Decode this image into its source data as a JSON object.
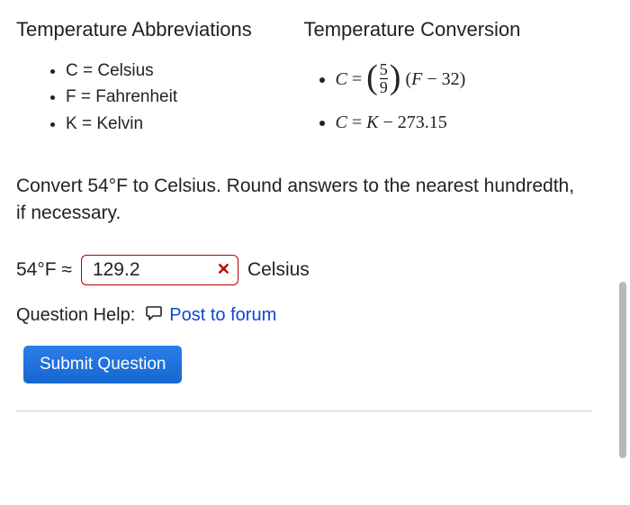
{
  "headings": {
    "abbrev": "Temperature Abbreviations",
    "conv": "Temperature Conversion"
  },
  "abbreviations": [
    "C = Celsius",
    "F = Fahrenheit",
    "K = Kelvin"
  ],
  "formulas": {
    "f1": {
      "lhs_var": "C",
      "frac_num": "5",
      "frac_den": "9",
      "rhs_var": "F",
      "const": "32"
    },
    "f2": {
      "lhs_var": "C",
      "rhs_var": "K",
      "const": "273.15"
    }
  },
  "prompt": "Convert 54°F to Celsius. Round answers to the nearest hundredth, if necessary.",
  "answer": {
    "lhs": "54°F ≈",
    "value": "129.2",
    "unit": "Celsius",
    "status_icon": "✕"
  },
  "help": {
    "label": "Question Help:",
    "link_text": "Post to forum"
  },
  "submit_label": "Submit Question"
}
